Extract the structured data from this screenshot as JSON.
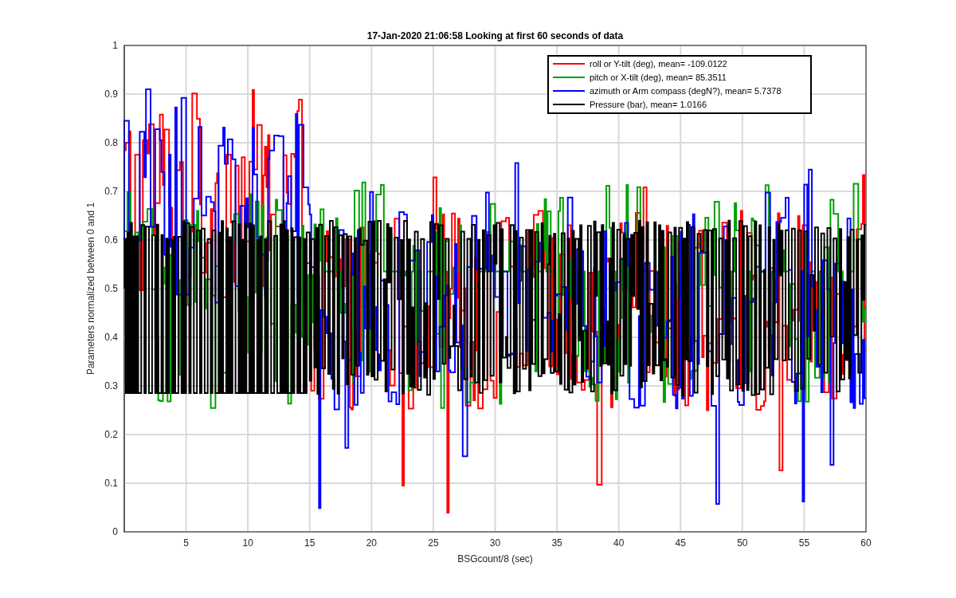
{
  "title": "17-Jan-2020 21:06:58 Looking at first 60 seconds of data",
  "xlabel": "BSGcount/8 (sec)",
  "ylabel": "Parameters normalized between 0 and 1",
  "xticks": [
    "5",
    "10",
    "15",
    "20",
    "25",
    "30",
    "35",
    "40",
    "45",
    "50",
    "55",
    "60"
  ],
  "yticks": [
    "1",
    "0.9",
    "0.8",
    "0.7",
    "0.6",
    "0.5",
    "0.4",
    "0.3",
    "0.2",
    "0.1",
    "0"
  ],
  "legend": [
    {
      "label": "roll or Y-tilt (deg), mean= -109.0122",
      "color": "#ff0000"
    },
    {
      "label": "pitch or X-tilt (deg), mean= 85.3511",
      "color": "#00a000"
    },
    {
      "label": "azimuth or Arm compass (degN?), mean= 5.7378",
      "color": "#0000ff"
    },
    {
      "label": "Pressure (bar), mean= 1.0166",
      "color": "#000000"
    }
  ]
}
